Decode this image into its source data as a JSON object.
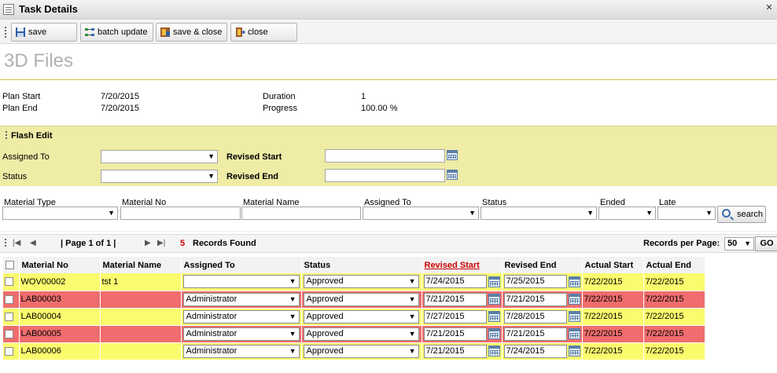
{
  "window": {
    "title": "Task Details"
  },
  "toolbar": {
    "save": "save",
    "batch_update": "batch update",
    "save_close": "save & close",
    "close": "close"
  },
  "page_title": "3D Files",
  "info": {
    "plan_start_label": "Plan Start",
    "plan_start": "7/20/2015",
    "plan_end_label": "Plan End",
    "plan_end": "7/20/2015",
    "duration_label": "Duration",
    "duration": "1",
    "progress_label": "Progress",
    "progress": "100.00 %"
  },
  "flash_edit": {
    "header": "Flash Edit",
    "assigned_to_label": "Assigned To",
    "status_label": "Status",
    "revised_start_label": "Revised Start",
    "revised_end_label": "Revised End"
  },
  "filters": {
    "material_type": "Material Type",
    "material_no": "Material No",
    "material_name": "Material Name",
    "assigned_to": "Assigned To",
    "status": "Status",
    "ended": "Ended",
    "late": "Late",
    "search": "search"
  },
  "pager": {
    "page_info": "| Page 1 of 1 |",
    "records_count": "5",
    "records_found": "Records Found",
    "per_page_label": "Records per Page:",
    "per_page": "50",
    "go": "GO"
  },
  "grid": {
    "columns": [
      "Material No",
      "Material Name",
      "Assigned To",
      "Status",
      "Revised Start",
      "Revised End",
      "Actual Start",
      "Actual End"
    ],
    "rows": [
      {
        "material_no": "WOV00002",
        "material_name": "tst 1",
        "assigned_to": "",
        "status": "Approved",
        "revised_start": "7/24/2015",
        "revised_end": "7/25/2015",
        "actual_start": "7/22/2015",
        "actual_end": "7/22/2015",
        "color": "yellow"
      },
      {
        "material_no": "LAB00003",
        "material_name": "",
        "assigned_to": "Administrator",
        "status": "Approved",
        "revised_start": "7/21/2015",
        "revised_end": "7/21/2015",
        "actual_start": "7/22/2015",
        "actual_end": "7/22/2015",
        "color": "red"
      },
      {
        "material_no": "LAB00004",
        "material_name": "",
        "assigned_to": "Administrator",
        "status": "Approved",
        "revised_start": "7/27/2015",
        "revised_end": "7/28/2015",
        "actual_start": "7/22/2015",
        "actual_end": "7/22/2015",
        "color": "yellow"
      },
      {
        "material_no": "LAB00005",
        "material_name": "",
        "assigned_to": "Administrator",
        "status": "Approved",
        "revised_start": "7/21/2015",
        "revised_end": "7/21/2015",
        "actual_start": "7/22/2015",
        "actual_end": "7/22/2015",
        "color": "red"
      },
      {
        "material_no": "LAB00006",
        "material_name": "",
        "assigned_to": "Administrator",
        "status": "Approved",
        "revised_start": "7/21/2015",
        "revised_end": "7/24/2015",
        "actual_start": "7/22/2015",
        "actual_end": "7/22/2015",
        "color": "yellow"
      }
    ]
  },
  "colors": {
    "row_yellow": "#fbfb6e",
    "row_red": "#f06d6d",
    "flash_bg": "#efeca6",
    "sort_header": "#cc0000",
    "records_count": "#cc0000"
  }
}
